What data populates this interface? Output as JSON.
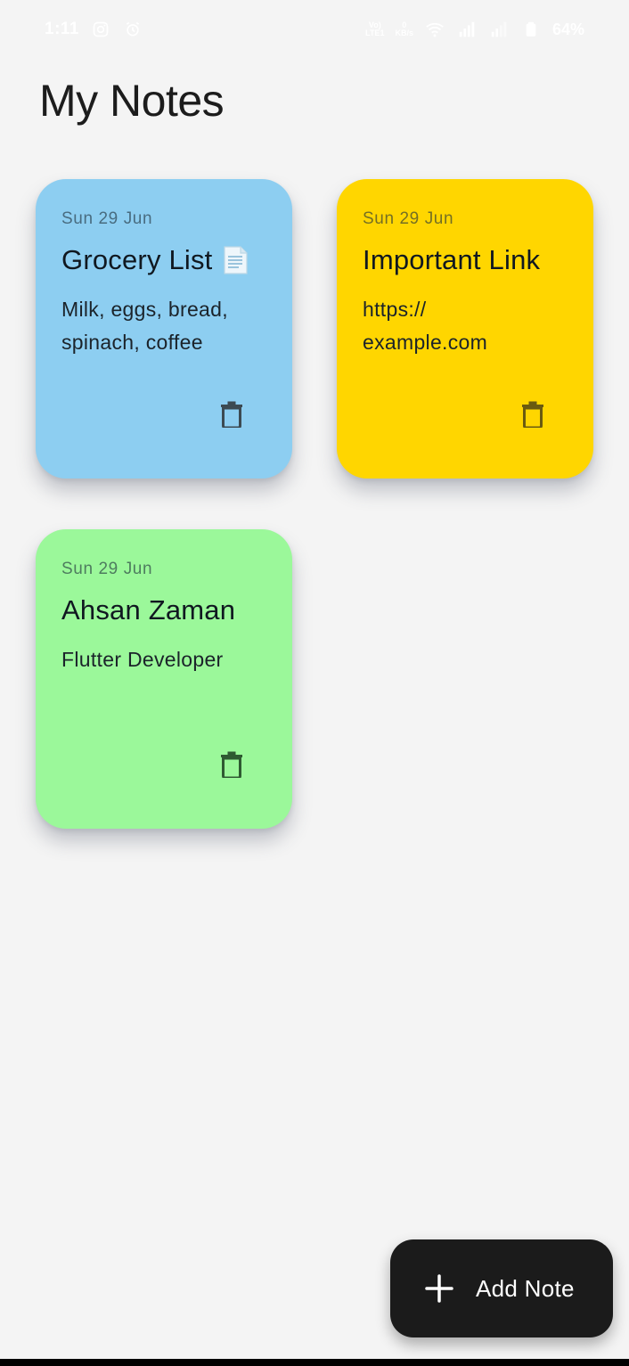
{
  "status_bar": {
    "time": "1:11",
    "battery": "64%",
    "net_top": "Vo)",
    "net_bottom": "LTE1",
    "speed_top": "0",
    "speed_bottom": "KB/s"
  },
  "header": {
    "title": "My Notes"
  },
  "notes": [
    {
      "date": "Sun 29 Jun",
      "title": "Grocery List",
      "emoji": "📃",
      "body": "Milk, eggs, bread, spinach, coffee",
      "color": "#8dcef1"
    },
    {
      "date": "Sun 29 Jun",
      "title": "Important Link",
      "body": "https:// example.com",
      "color": "#ffd600"
    },
    {
      "date": "Sun 29 Jun",
      "title": "Ahsan Zaman",
      "body": "Flutter Developer",
      "color": "#9bf89a"
    }
  ],
  "fab": {
    "label": "Add Note"
  },
  "colors": {
    "background": "#f4f4f4",
    "fab": "#1b1b1b",
    "delete_icon": "#3c4a52"
  }
}
